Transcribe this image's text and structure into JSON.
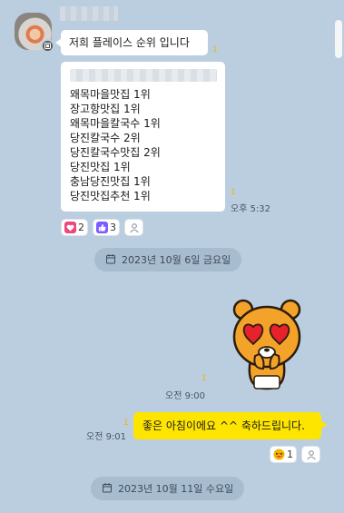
{
  "colors": {
    "background": "#bacee0",
    "received_bubble": "#ffffff",
    "sent_bubble": "#fee500",
    "unread_count": "#f0b400",
    "date_pill": "#a7bccf"
  },
  "thread": {
    "received": {
      "first_message": "저희 플레이스 순위 입니다",
      "first_unread": "1",
      "list_rows": [
        "왜목마을맛집 1위",
        "장고항맛집 1위",
        "왜목마을칼국수 1위",
        "당진칼국수 2위",
        "당진칼국수맛집 2위",
        "당진맛집 1위",
        "충남당진맛집 1위",
        "당진맛집추천 1위"
      ],
      "list_unread": "1",
      "time": "오후 5:32",
      "reactions": [
        {
          "icon": "heart-icon",
          "count": "2",
          "color": "#f0457a"
        },
        {
          "icon": "thumbs-up-icon",
          "count": "3",
          "color": "#7b5cff"
        },
        {
          "icon": "person-icon",
          "count": "",
          "color": "#8a96a3"
        }
      ]
    },
    "date_divider_1": "2023년 10월 6일 금요일",
    "sent": {
      "emoticon_unread": "1",
      "emoticon_time": "오전 9:00",
      "message": "좋은 아침이에요 ^^ 축하드립니다.",
      "message_unread": "1",
      "message_time": "오전 9:01",
      "reactions": [
        {
          "icon": "laughing-face-icon",
          "count": "1",
          "color": "#f5b301"
        },
        {
          "icon": "person-icon",
          "count": "",
          "color": "#8a96a3"
        }
      ]
    },
    "date_divider_2": "2023년 10월 11일 수요일"
  }
}
